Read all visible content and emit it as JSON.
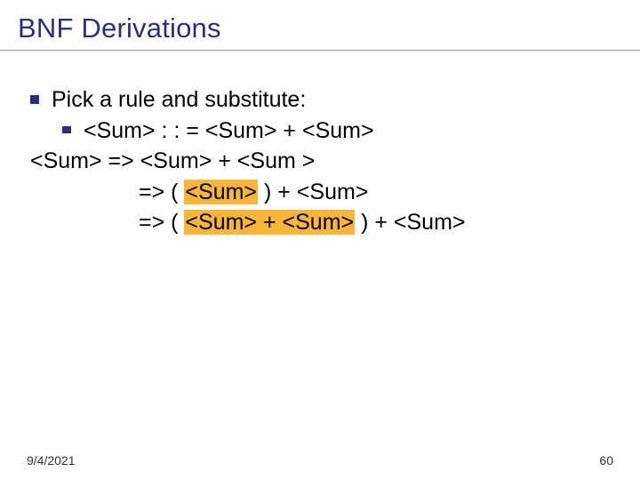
{
  "title": "BNF Derivations",
  "bullet1": "Pick a rule and substitute:",
  "bullet2": "<Sum> : : = <Sum> + <Sum>",
  "deriv": {
    "l1a": "<Sum> => <Sum> + <Sum >",
    "l2a": "=> ( ",
    "l2hl": "<Sum>",
    "l2b": " ) + <Sum>",
    "l3a": "=> ( ",
    "l3hl": "<Sum> + <Sum>",
    "l3b": " ) + <Sum>"
  },
  "footer": {
    "date": "9/4/2021",
    "page": "60"
  }
}
